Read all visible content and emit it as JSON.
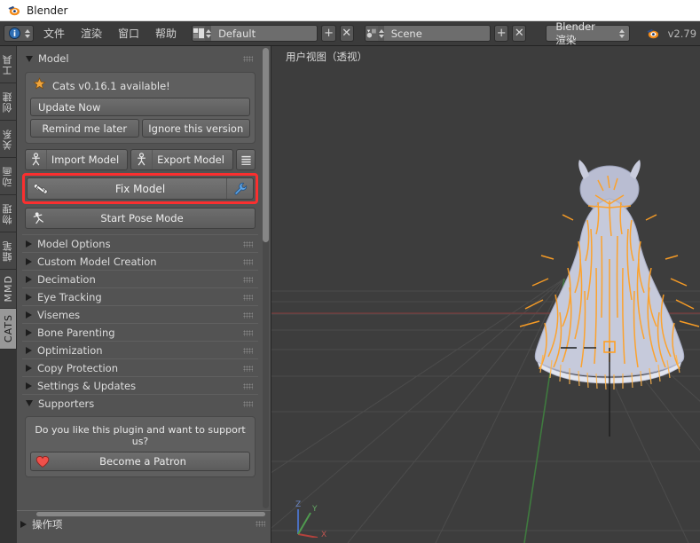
{
  "window": {
    "title": "Blender",
    "logo_icon": "blender-logo-icon"
  },
  "topbar": {
    "editor_type_icon": "info-editor-icon",
    "menus": [
      {
        "label": "文件",
        "name": "menu-file"
      },
      {
        "label": "渲染",
        "name": "menu-render"
      },
      {
        "label": "窗口",
        "name": "menu-window"
      },
      {
        "label": "帮助",
        "name": "menu-help"
      }
    ],
    "screen_layout": {
      "icon": "screen-layout-icon",
      "value": "Default",
      "add_label": "+",
      "delete_label": "✕"
    },
    "scene": {
      "icon": "scene-icon",
      "value": "Scene",
      "add_label": "+",
      "delete_label": "✕"
    },
    "render_engine": {
      "value": "Blender 渲染"
    },
    "version": "v2.79",
    "version_icon": "blender-logo-icon"
  },
  "tabstrip": {
    "tabs": [
      {
        "label": "工具",
        "active": false,
        "name": "tab-tools"
      },
      {
        "label": "创建",
        "active": false,
        "name": "tab-create"
      },
      {
        "label": "关系",
        "active": false,
        "name": "tab-relations"
      },
      {
        "label": "动画",
        "active": false,
        "name": "tab-animation"
      },
      {
        "label": "物理",
        "active": false,
        "name": "tab-physics"
      },
      {
        "label": "蜡笔",
        "active": false,
        "name": "tab-grease-pencil"
      },
      {
        "label": "MMD",
        "active": false,
        "name": "tab-mmd"
      },
      {
        "label": "CATS",
        "active": true,
        "name": "tab-cats"
      }
    ]
  },
  "sidepanel": {
    "model_section": {
      "title": "Model",
      "expanded": true
    },
    "update_notice": {
      "star_icon": "star-icon",
      "message": "Cats v0.16.1 available!",
      "update_now_label": "Update Now",
      "remind_label": "Remind me later",
      "ignore_label": "Ignore this version"
    },
    "model_buttons": {
      "import_label": "Import Model",
      "import_icon": "armature-icon",
      "export_label": "Export Model",
      "export_icon": "armature-icon",
      "list_icon": "list-icon",
      "fix_model_label": "Fix Model",
      "fix_model_icon": "bone-icon",
      "fix_model_settings_icon": "wrench-icon",
      "pose_mode_label": "Start Pose Mode",
      "pose_mode_icon": "pose-icon"
    },
    "sections": [
      {
        "label": "Model Options",
        "expanded": false,
        "name": "section-model-options"
      },
      {
        "label": "Custom Model Creation",
        "expanded": false,
        "name": "section-custom-model-creation"
      },
      {
        "label": "Decimation",
        "expanded": false,
        "name": "section-decimation"
      },
      {
        "label": "Eye Tracking",
        "expanded": false,
        "name": "section-eye-tracking"
      },
      {
        "label": "Visemes",
        "expanded": false,
        "name": "section-visemes"
      },
      {
        "label": "Bone Parenting",
        "expanded": false,
        "name": "section-bone-parenting"
      },
      {
        "label": "Optimization",
        "expanded": false,
        "name": "section-optimization"
      },
      {
        "label": "Copy Protection",
        "expanded": false,
        "name": "section-copy-protection"
      },
      {
        "label": "Settings & Updates",
        "expanded": false,
        "name": "section-settings-updates"
      },
      {
        "label": "Supporters",
        "expanded": true,
        "name": "section-supporters"
      }
    ],
    "supporters": {
      "question": "Do you like this plugin and want to support us?",
      "patron_label": "Become a Patron",
      "heart_icon": "heart-icon"
    }
  },
  "operator_panel": {
    "label": "操作项",
    "expanded": false
  },
  "viewport": {
    "view_label": "用户视图（透视）",
    "axis_gizmo": {
      "z_label": "Z",
      "y_label": "Y",
      "x_label": "X"
    }
  },
  "colors": {
    "highlight": "#fa2f2f",
    "selection_orange": "#ffa024",
    "panel_bg": "#535353",
    "viewport_bg": "#3d3d3d",
    "header_bg": "#3b3b3b",
    "active_tab": "#989898"
  }
}
